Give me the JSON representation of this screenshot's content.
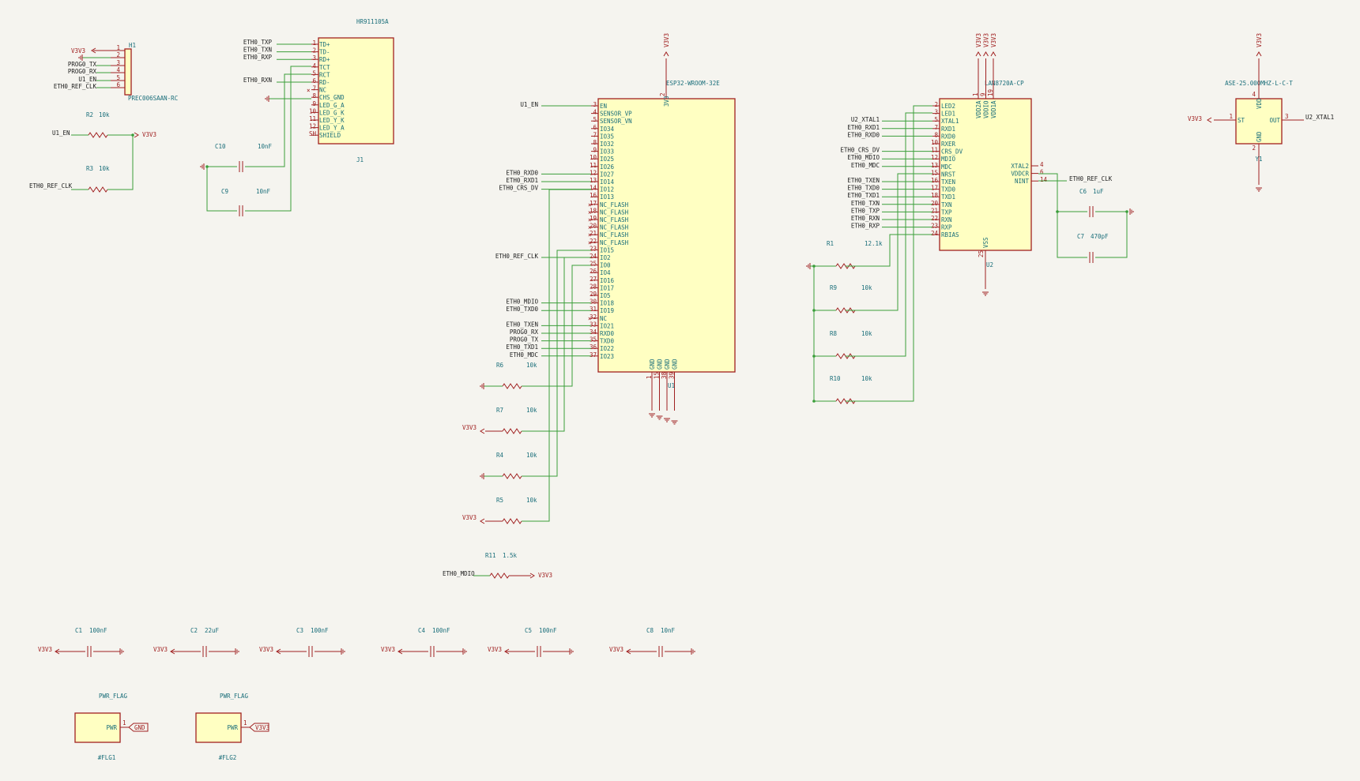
{
  "h1": {
    "ref": "H1",
    "value": "PREC006SAAN-RC",
    "pins": [
      "1",
      "2",
      "3",
      "4",
      "5",
      "6"
    ],
    "nets": [
      "V3V3",
      "PROG0_TX",
      "PROG0_RX",
      "U1_EN",
      "ETH0_REF_CLK"
    ]
  },
  "resistors": [
    {
      "ref": "R2",
      "value": "10k",
      "net_left": "U1_EN",
      "net_right": "V3V3"
    },
    {
      "ref": "R3",
      "value": "10k",
      "net_left": "ETH0_REF_CLK"
    },
    {
      "ref": "R6",
      "value": "10k"
    },
    {
      "ref": "R7",
      "value": "10k",
      "net_left": "V3V3"
    },
    {
      "ref": "R4",
      "value": "10k"
    },
    {
      "ref": "R5",
      "value": "10k",
      "net_left": "V3V3"
    },
    {
      "ref": "R11",
      "value": "1.5k",
      "net_left": "ETH0_MDIO",
      "net_right": "V3V3"
    },
    {
      "ref": "R1",
      "value": "12.1k"
    },
    {
      "ref": "R9",
      "value": "10k"
    },
    {
      "ref": "R8",
      "value": "10k"
    },
    {
      "ref": "R10",
      "value": "10k"
    }
  ],
  "j1": {
    "ref": "J1",
    "value": "HR911105A",
    "pins": [
      [
        "1",
        "TD+"
      ],
      [
        "2",
        "TD-"
      ],
      [
        "3",
        "RD+"
      ],
      [
        "4",
        "TCT"
      ],
      [
        "5",
        "RCT"
      ],
      [
        "6",
        "RD-"
      ],
      [
        "7",
        "NC"
      ],
      [
        "8",
        "CHS_GND"
      ],
      [
        "9",
        "LED_G_A"
      ],
      [
        "10",
        "LED_G_K"
      ],
      [
        "11",
        "LED_Y_K"
      ],
      [
        "12",
        "LED_Y_A"
      ],
      [
        "SH",
        "SHIELD"
      ]
    ],
    "nets": [
      "ETH0_TXP",
      "ETH0_TXN",
      "ETH0_RXP",
      "ETH0_RXN"
    ]
  },
  "j1caps": [
    {
      "ref": "C10",
      "value": "10nF"
    },
    {
      "ref": "C9",
      "value": "10nF"
    }
  ],
  "u1": {
    "ref": "U1",
    "value": "ESP32-WROOM-32E",
    "top_pin": "3V3",
    "top_pin_num": "2",
    "top_net": "V3V3",
    "pins": [
      [
        "3",
        "EN"
      ],
      [
        "4",
        "SENSOR_VP"
      ],
      [
        "5",
        "SENSOR_VN"
      ],
      [
        "6",
        "IO34"
      ],
      [
        "7",
        "IO35"
      ],
      [
        "8",
        "IO32"
      ],
      [
        "9",
        "IO33"
      ],
      [
        "10",
        "IO25"
      ],
      [
        "11",
        "IO26"
      ],
      [
        "12",
        "IO27"
      ],
      [
        "13",
        "IO14"
      ],
      [
        "14",
        "IO12"
      ],
      [
        "16",
        "IO13"
      ],
      [
        "17",
        "NC_FLASH"
      ],
      [
        "18",
        "NC_FLASH"
      ],
      [
        "19",
        "NC_FLASH"
      ],
      [
        "20",
        "NC_FLASH"
      ],
      [
        "21",
        "NC_FLASH"
      ],
      [
        "22",
        "NC_FLASH"
      ],
      [
        "23",
        "IO15"
      ],
      [
        "24",
        "IO2"
      ],
      [
        "25",
        "IO0"
      ],
      [
        "26",
        "IO4"
      ],
      [
        "27",
        "IO16"
      ],
      [
        "28",
        "IO17"
      ],
      [
        "29",
        "IO5"
      ],
      [
        "30",
        "IO18"
      ],
      [
        "31",
        "IO19"
      ],
      [
        "32",
        "NC"
      ],
      [
        "33",
        "IO21"
      ],
      [
        "34",
        "RXD0"
      ],
      [
        "35",
        "TXD0"
      ],
      [
        "36",
        "IO22"
      ],
      [
        "37",
        "IO23"
      ]
    ],
    "bottom_pins": [
      [
        "1",
        "GND"
      ],
      [
        "15",
        "GND"
      ],
      [
        "38",
        "GND"
      ],
      [
        "39",
        "GND"
      ]
    ],
    "nets": [
      {
        "row": 0,
        "net": "U1_EN"
      },
      {
        "row": 9,
        "net": "ETH0_RXD0"
      },
      {
        "row": 10,
        "net": "ETH0_RXD1"
      },
      {
        "row": 11,
        "net": "ETH0_CRS_DV"
      },
      {
        "row": 20,
        "net": "ETH0_REF_CLK"
      },
      {
        "row": 26,
        "net": "ETH0_MDIO"
      },
      {
        "row": 27,
        "net": "ETH0_TXD0"
      },
      {
        "row": 29,
        "net": "ETH0_TXEN"
      },
      {
        "row": 30,
        "net": "PROG0_RX"
      },
      {
        "row": 31,
        "net": "PROG0_TX"
      },
      {
        "row": 32,
        "net": "ETH0_TXD1"
      },
      {
        "row": 33,
        "net": "ETH0_MDC"
      }
    ]
  },
  "u2": {
    "ref": "U2",
    "value": "LAN8720A-CP",
    "top_pins": [
      [
        "1",
        "VDD2A"
      ],
      [
        "9",
        "VDDIO"
      ],
      [
        "19",
        "VDD1A"
      ]
    ],
    "top_nets": [
      "V3V3",
      "V3V3",
      "V3V3"
    ],
    "pins": [
      [
        "2",
        "LED2"
      ],
      [
        "3",
        "LED1"
      ],
      [
        "5",
        "XTAL1"
      ],
      [
        "7",
        "RXD1"
      ],
      [
        "8",
        "RXD0"
      ],
      [
        "10",
        "RXER"
      ],
      [
        "11",
        "CRS_DV"
      ],
      [
        "12",
        "MDIO"
      ],
      [
        "13",
        "MDC"
      ],
      [
        "15",
        "NRST"
      ],
      [
        "16",
        "TXEN"
      ],
      [
        "17",
        "TXD0"
      ],
      [
        "18",
        "TXD1"
      ],
      [
        "20",
        "TXN"
      ],
      [
        "21",
        "TXP"
      ],
      [
        "22",
        "RXN"
      ],
      [
        "23",
        "RXP"
      ],
      [
        "24",
        "RBIAS"
      ]
    ],
    "right_pins": [
      [
        "4",
        "XTAL2"
      ],
      [
        "6",
        "VDDCR"
      ],
      [
        "14",
        "NINT"
      ]
    ],
    "bottom_pin": [
      "25",
      "VSS"
    ],
    "nets": [
      {
        "row": 2,
        "net": "U2_XTAL1"
      },
      {
        "row": 3,
        "net": "ETH0_RXD1"
      },
      {
        "row": 4,
        "net": "ETH0_RXD0"
      },
      {
        "row": 6,
        "net": "ETH0_CRS_DV"
      },
      {
        "row": 7,
        "net": "ETH0_MDIO"
      },
      {
        "row": 8,
        "net": "ETH0_MDC"
      },
      {
        "row": 10,
        "net": "ETH0_TXEN"
      },
      {
        "row": 11,
        "net": "ETH0_TXD0"
      },
      {
        "row": 12,
        "net": "ETH0_TXD1"
      },
      {
        "row": 13,
        "net": "ETH0_TXN"
      },
      {
        "row": 14,
        "net": "ETH0_TXP"
      },
      {
        "row": 15,
        "net": "ETH0_RXN"
      },
      {
        "row": 16,
        "net": "ETH0_RXP"
      }
    ],
    "nint_net": "ETH0_REF_CLK"
  },
  "u2caps": [
    {
      "ref": "C6",
      "value": "1uF"
    },
    {
      "ref": "C7",
      "value": "470pF"
    }
  ],
  "y1": {
    "ref": "Y1",
    "value": "ASE-25.000MHZ-L-C-T",
    "pin1": [
      "1",
      "ST"
    ],
    "pin3": [
      "3",
      "OUT"
    ],
    "pin4": [
      "4",
      "VDD"
    ],
    "pin2": [
      "2",
      "GND"
    ],
    "net_left": "V3V3",
    "net_right": "U2_XTAL1",
    "net_top": "V3V3"
  },
  "decoupling": [
    {
      "ref": "C1",
      "value": "100nF",
      "net": "V3V3"
    },
    {
      "ref": "C2",
      "value": "22uF",
      "net": "V3V3"
    },
    {
      "ref": "C3",
      "value": "100nF",
      "net": "V3V3"
    },
    {
      "ref": "C4",
      "value": "100nF",
      "net": "V3V3"
    },
    {
      "ref": "C5",
      "value": "100nF",
      "net": "V3V3"
    },
    {
      "ref": "C8",
      "value": "10nF",
      "net": "V3V3"
    }
  ],
  "flags": [
    {
      "label": "PWR_FLAG",
      "ref": "#FLG1",
      "pin": "PWR",
      "pinnum": "1",
      "net": "GND"
    },
    {
      "label": "PWR_FLAG",
      "ref": "#FLG2",
      "pin": "PWR",
      "pinnum": "1",
      "net": "V3V3"
    }
  ],
  "colors": {
    "background": "#f5f4ef",
    "body": "#ffffc2",
    "symbol": "#a02020",
    "wire": "#3a9e3a",
    "reference": "#1a6e7a"
  }
}
